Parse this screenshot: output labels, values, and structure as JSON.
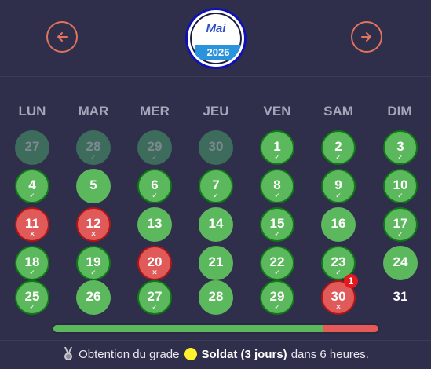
{
  "header": {
    "month": "Mai",
    "year": "2026",
    "prev_icon": "arrow-left-icon",
    "next_icon": "arrow-right-icon",
    "badge_color": "#0f10b6",
    "accent": "#e0745d"
  },
  "weekdays": [
    "LUN",
    "MAR",
    "MER",
    "JEU",
    "VEN",
    "SAM",
    "DIM"
  ],
  "days": [
    {
      "num": "27",
      "state": "past",
      "mark": "none"
    },
    {
      "num": "28",
      "state": "past",
      "mark": "check"
    },
    {
      "num": "29",
      "state": "past",
      "mark": "check"
    },
    {
      "num": "30",
      "state": "past",
      "mark": "none"
    },
    {
      "num": "1",
      "state": "ok",
      "mark": "check"
    },
    {
      "num": "2",
      "state": "ok",
      "mark": "check"
    },
    {
      "num": "3",
      "state": "ok",
      "mark": "check"
    },
    {
      "num": "4",
      "state": "ok",
      "mark": "check"
    },
    {
      "num": "5",
      "state": "plain",
      "mark": "none"
    },
    {
      "num": "6",
      "state": "ok",
      "mark": "check"
    },
    {
      "num": "7",
      "state": "ok",
      "mark": "check"
    },
    {
      "num": "8",
      "state": "ok",
      "mark": "check"
    },
    {
      "num": "9",
      "state": "ok",
      "mark": "check"
    },
    {
      "num": "10",
      "state": "ok",
      "mark": "check"
    },
    {
      "num": "11",
      "state": "miss",
      "mark": "cross"
    },
    {
      "num": "12",
      "state": "miss",
      "mark": "cross"
    },
    {
      "num": "13",
      "state": "plain",
      "mark": "none"
    },
    {
      "num": "14",
      "state": "plain",
      "mark": "none"
    },
    {
      "num": "15",
      "state": "ok",
      "mark": "check"
    },
    {
      "num": "16",
      "state": "plain",
      "mark": "none"
    },
    {
      "num": "17",
      "state": "ok",
      "mark": "check"
    },
    {
      "num": "18",
      "state": "ok",
      "mark": "check"
    },
    {
      "num": "19",
      "state": "ok",
      "mark": "check"
    },
    {
      "num": "20",
      "state": "miss",
      "mark": "cross"
    },
    {
      "num": "21",
      "state": "plain",
      "mark": "none"
    },
    {
      "num": "22",
      "state": "ok",
      "mark": "check"
    },
    {
      "num": "23",
      "state": "ok",
      "mark": "check"
    },
    {
      "num": "24",
      "state": "plain",
      "mark": "none"
    },
    {
      "num": "25",
      "state": "ok",
      "mark": "check"
    },
    {
      "num": "26",
      "state": "plain",
      "mark": "none"
    },
    {
      "num": "27",
      "state": "ok",
      "mark": "check"
    },
    {
      "num": "28",
      "state": "plain",
      "mark": "none"
    },
    {
      "num": "29",
      "state": "ok",
      "mark": "check"
    },
    {
      "num": "30",
      "state": "miss",
      "mark": "cross",
      "notification": "1"
    },
    {
      "num": "31",
      "state": "empty",
      "mark": "none"
    }
  ],
  "progress": {
    "fraction": 0.83,
    "fill_color": "#5cb85c",
    "rest_color": "#e55959"
  },
  "footer": {
    "icon": "medal-icon",
    "prefix": "Obtention du grade",
    "rank_dot_color": "#fff22c",
    "rank": "Soldat (3 jours)",
    "suffix": "dans 6 heures."
  },
  "colors": {
    "background": "#2f2e4b",
    "success": "#5cb85c",
    "danger": "#e05a5a"
  }
}
